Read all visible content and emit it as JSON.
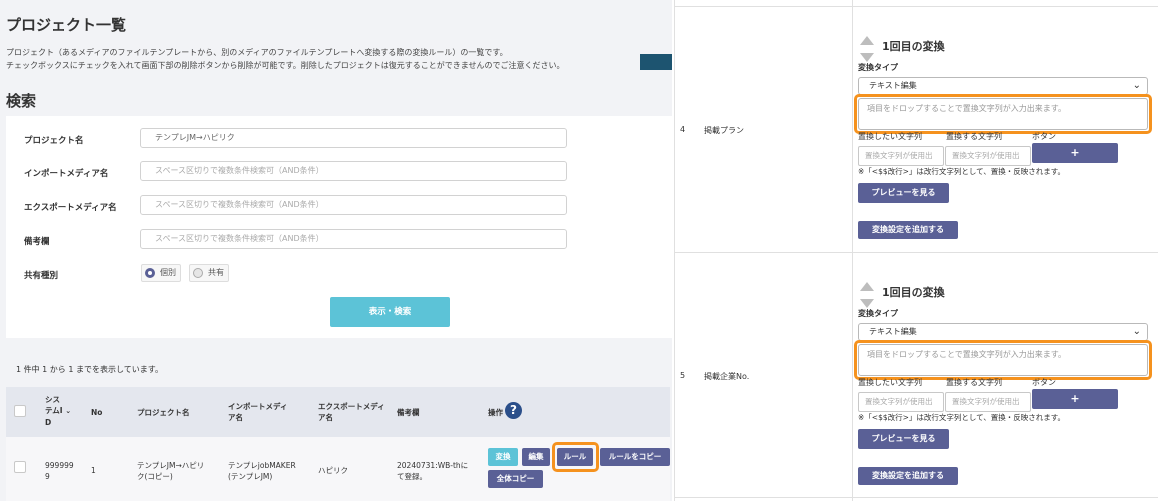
{
  "left": {
    "title": "プロジェクト一覧",
    "desc_line1": "プロジェクト（あるメディアのファイルテンプレートから、別のメディアのファイルテンプレートへ変換する際の変換ルール）の一覧です。",
    "desc_line2": "チェックボックスにチェックを入れて画面下部の削除ボタンから削除が可能です。削除したプロジェクトは復元することができませんのでご注意ください。",
    "search_title": "検索",
    "fields": [
      {
        "label": "プロジェクト名",
        "value": "テンプレJM→ハピリク",
        "placeholder": ""
      },
      {
        "label": "インポートメディア名",
        "value": "",
        "placeholder": "スペース区切りで複数条件検索可（AND条件）"
      },
      {
        "label": "エクスポートメディア名",
        "value": "",
        "placeholder": "スペース区切りで複数条件検索可（AND条件）"
      },
      {
        "label": "備考欄",
        "value": "",
        "placeholder": "スペース区切りで複数条件検索可（AND条件）"
      }
    ],
    "share_label": "共有種別",
    "radio_options": [
      "個別",
      "共有"
    ],
    "radio_selected": "個別",
    "search_button": "表示・検索",
    "result_count": "1 件中 1 から 1 までを表示しています。",
    "columns": {
      "system_id_1": "シス",
      "system_id_2": "テムI",
      "system_id_3": "D",
      "no": "No",
      "project_name": "プロジェクト名",
      "import_media_1": "インポートメディ",
      "import_media_2": "ア名",
      "export_media_1": "エクスポートメディ",
      "export_media_2": "ア名",
      "remarks": "備考欄",
      "operation": "操作"
    },
    "row": {
      "system_id_1": "999999",
      "system_id_2": "9",
      "no": "1",
      "project_name_1": "テンプレJM→ハピリ",
      "project_name_2": "ク(コピー)",
      "import_media_1": "テンプレjobMAKER",
      "import_media_2": "(テンプレJM)",
      "export_media": "ハピリク",
      "remarks_1": "20240731:WB-thに",
      "remarks_2": "て登録。"
    },
    "actions": {
      "convert": "変換",
      "edit": "編集",
      "rule": "ルール",
      "copy_rule": "ルールをコピー",
      "copy_all": "全体コピー"
    }
  },
  "right": {
    "rows": [
      {
        "num": "4",
        "name": "掲載プラン",
        "conv_title": "1回目の変換",
        "type_label": "変換タイプ",
        "type_value": "テキスト編集",
        "textarea_placeholder": "項目をドロップすることで置換文字列が入力出来ます。",
        "col1": "置換したい文字列",
        "col2": "置換する文字列",
        "col3": "ボタン",
        "in1_placeholder": "置換文字列が使用出",
        "in2_placeholder": "置換文字列が使用出",
        "plus": "+",
        "note": "※「<$$改行>」は改行文字列として、置換・反映されます。",
        "preview": "プレビューを見る",
        "add": "変換設定を追加する"
      },
      {
        "num": "5",
        "name": "掲載企業No.",
        "conv_title": "1回目の変換",
        "type_label": "変換タイプ",
        "type_value": "テキスト編集",
        "textarea_placeholder": "項目をドロップすることで置換文字列が入力出来ます。",
        "col1": "置換したい文字列",
        "col2": "置換する文字列",
        "col3": "ボタン",
        "in1_placeholder": "置換文字列が使用出",
        "in2_placeholder": "置換文字列が使用出",
        "plus": "+",
        "note": "※「<$$改行>」は改行文字列として、置換・反映されます。",
        "preview": "プレビューを見る",
        "add": "変換設定を追加する"
      }
    ]
  },
  "colors": {
    "accent_teal": "#5cc3d7",
    "button_purple": "#5a6096",
    "highlight_orange": "#f5921e",
    "arrow": "#1d5470"
  }
}
